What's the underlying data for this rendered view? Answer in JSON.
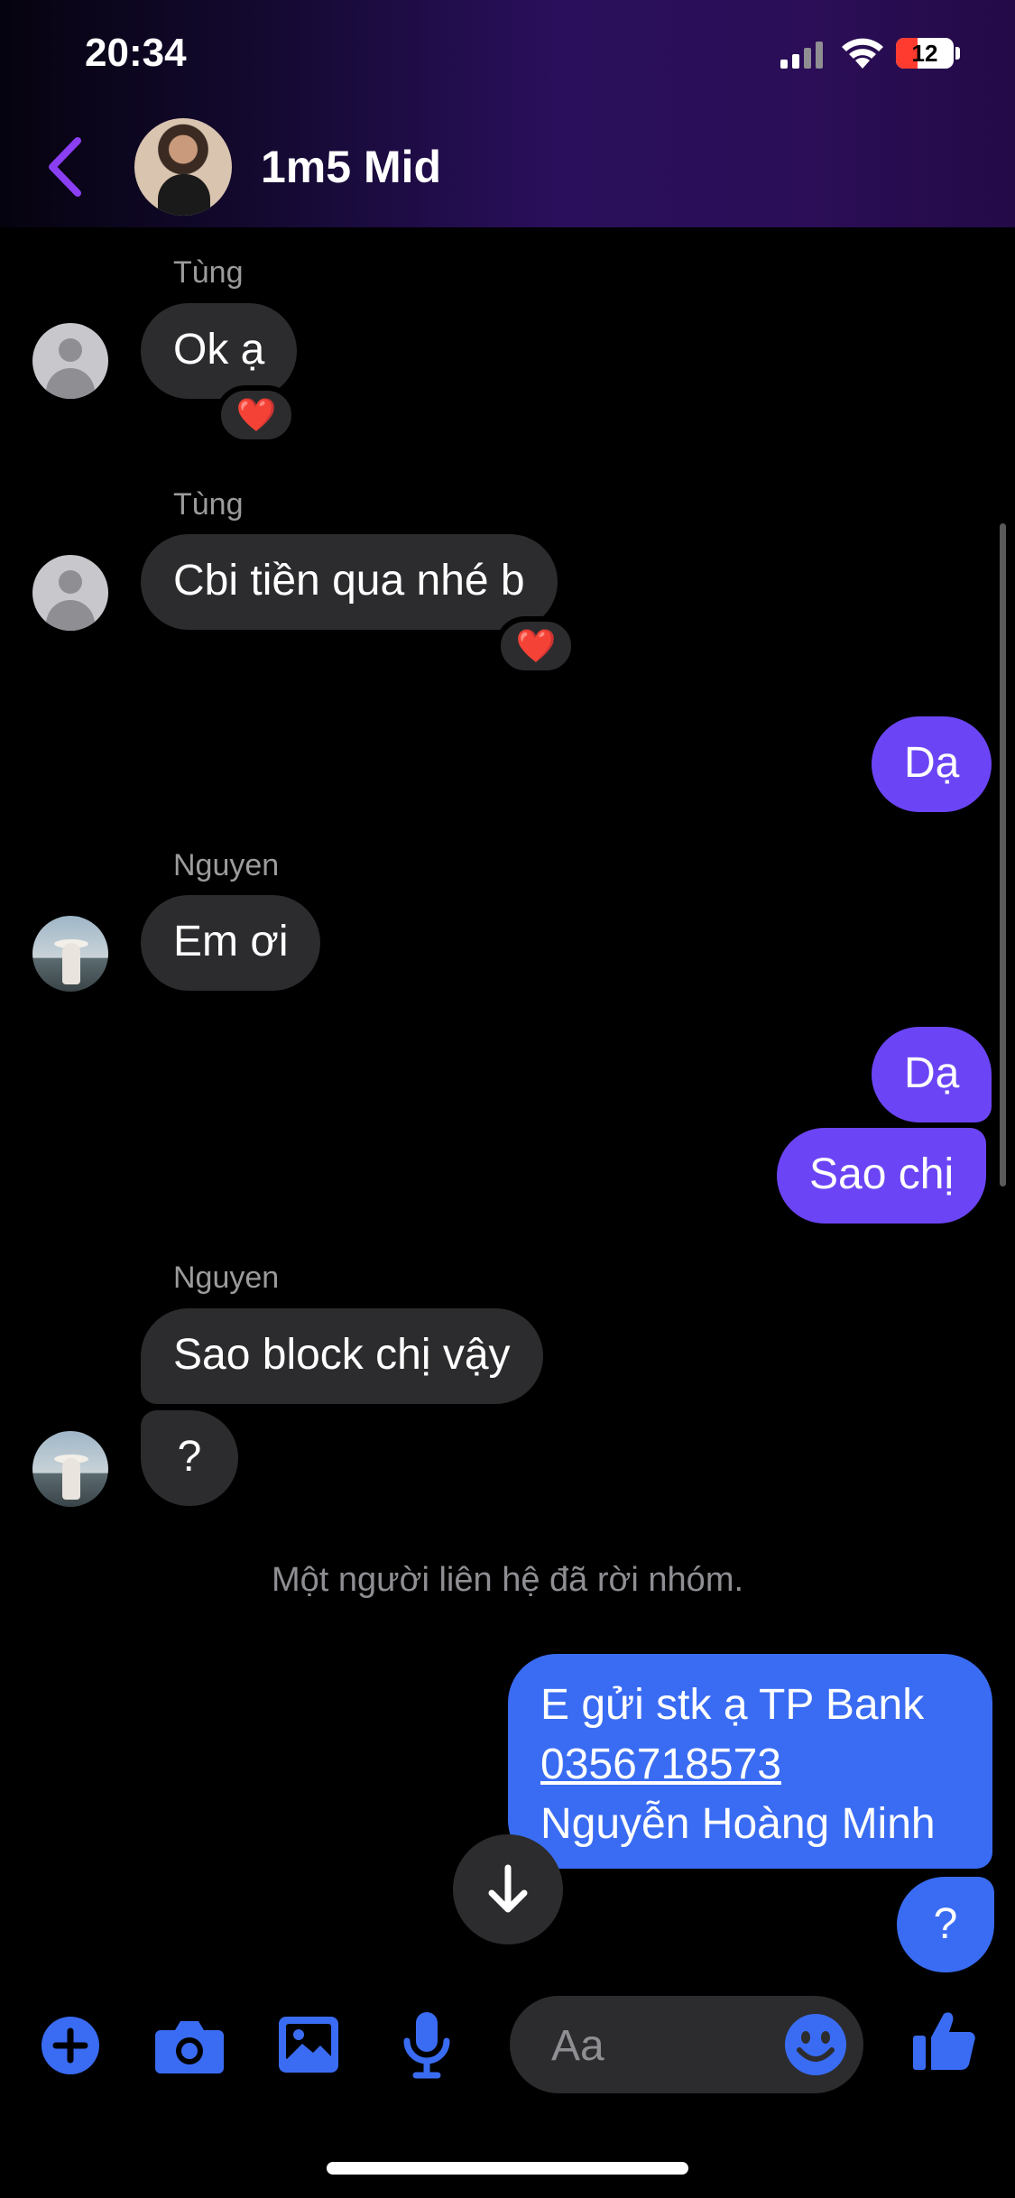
{
  "status_bar": {
    "time": "20:34",
    "battery": "12"
  },
  "header": {
    "title": "1m5 Mid"
  },
  "messages": {
    "m1": {
      "sender": "Tùng",
      "text": "Ok ạ",
      "reaction": "❤️"
    },
    "m2": {
      "sender": "Tùng",
      "text": "Cbi tiền qua nhé b",
      "reaction": "❤️"
    },
    "m3": {
      "text": "Dạ"
    },
    "m4": {
      "sender": "Nguyen",
      "text": "Em ơi"
    },
    "m5": {
      "text": "Dạ"
    },
    "m6": {
      "text": "Sao chị"
    },
    "m7": {
      "sender": "Nguyen",
      "text": "Sao block chị vậy"
    },
    "m8": {
      "text": "?"
    },
    "system": "Một người liên hệ đã rời nhóm.",
    "m9": {
      "line1": "E gửi stk ạ TP Bank",
      "account": "0356718573",
      "line3": "Nguyễn Hoàng Minh"
    },
    "m10": {
      "text": "?"
    }
  },
  "composer": {
    "placeholder": "Aa"
  },
  "icons": {
    "plus": "plus-circle-icon",
    "camera": "camera-icon",
    "gallery": "image-icon",
    "mic": "microphone-icon",
    "emoji": "emoji-icon",
    "like": "thumbs-up-icon"
  },
  "colors": {
    "accent": "#3a6cf3",
    "outgoing": "#6b45f5",
    "incoming": "#2c2c2e"
  }
}
